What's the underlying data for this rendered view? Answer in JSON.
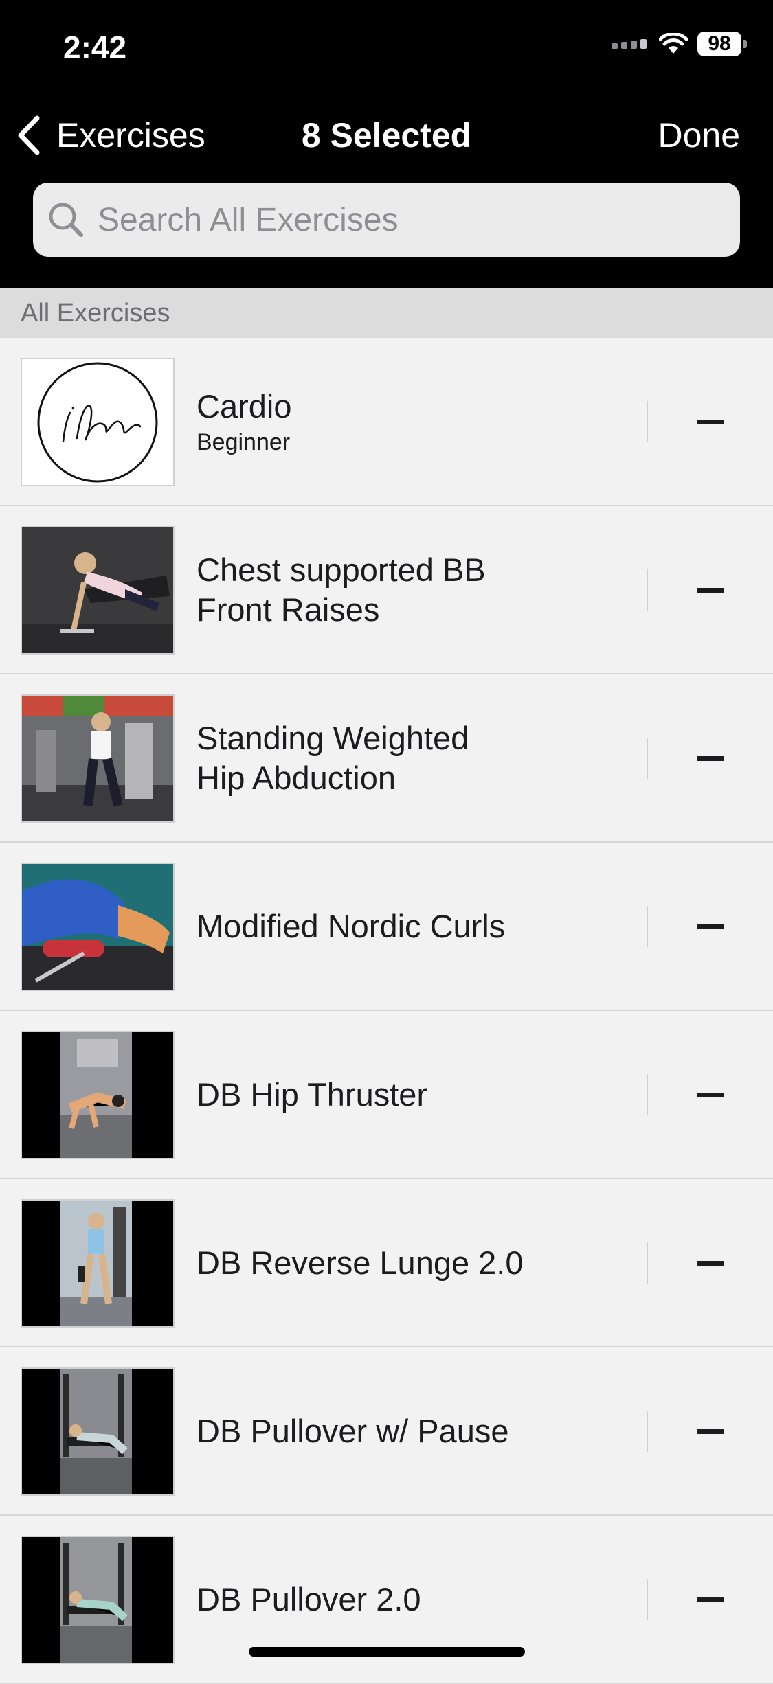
{
  "status_bar": {
    "time": "2:42",
    "battery": "98",
    "icons": [
      "signal-icon",
      "wifi-icon",
      "battery-icon"
    ]
  },
  "nav": {
    "back_label": "Exercises",
    "title": "8 Selected",
    "done_label": "Done"
  },
  "search": {
    "placeholder": "Search All Exercises",
    "value": ""
  },
  "section_header": "All Exercises",
  "exercises": [
    {
      "title": "Cardio",
      "subtitle": "Beginner"
    },
    {
      "title": "Chest supported BB\nFront Raises"
    },
    {
      "title": "Standing Weighted\nHip Abduction"
    },
    {
      "title": "Modified Nordic Curls"
    },
    {
      "title": "DB Hip Thruster"
    },
    {
      "title": "DB Reverse Lunge 2.0"
    },
    {
      "title": "DB Pullover w/ Pause"
    },
    {
      "title": "DB Pullover 2.0"
    }
  ],
  "colors": {
    "header_bg": "#000000",
    "list_bg": "#f2f2f2",
    "section_bg": "#dcdcdc"
  }
}
